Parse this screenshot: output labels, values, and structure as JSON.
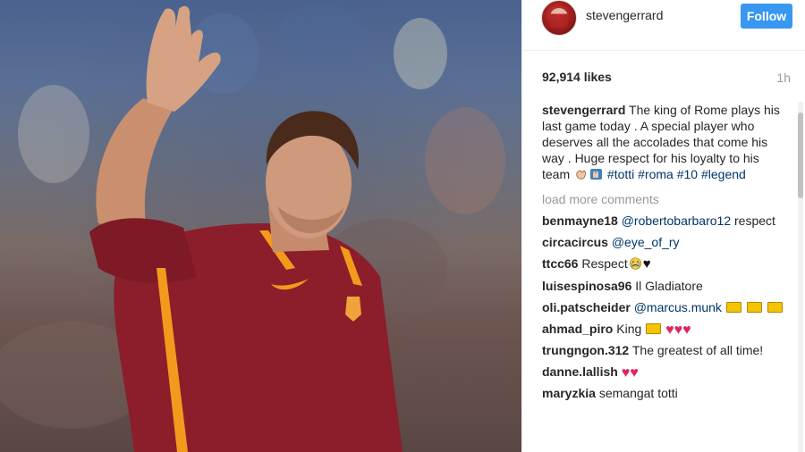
{
  "post": {
    "username": "stevengerrard",
    "follow_label": "Follow",
    "likes": "92,914 likes",
    "time": "1h"
  },
  "caption": {
    "user": "stevengerrard",
    "text": "The king of Rome plays his last game today . A special player who deserves all the accolades that come his way . Huge respect for his loyalty to his team",
    "tags": [
      "#totti",
      "#roma",
      "#10",
      "#legend"
    ]
  },
  "load_more": "load more comments",
  "comments": [
    {
      "user": "benmayne18",
      "mention": "@robertobarbaro12",
      "text": "respect"
    },
    {
      "user": "circacircus",
      "mention": "@eye_of_ry",
      "text": ""
    },
    {
      "user": "ttcc66",
      "text": "Respect"
    },
    {
      "user": "luisespinosa96",
      "text": "Il Gladiatore"
    },
    {
      "user": "oli.patscheider",
      "mention": "@marcus.munk",
      "text": ""
    },
    {
      "user": "ahmad_piro",
      "text": "King"
    },
    {
      "user": "trungngon.312",
      "text": "The greatest of all time!"
    },
    {
      "user": "danne.lallish",
      "text": ""
    },
    {
      "user": "maryzkia",
      "text": "semangat totti"
    }
  ],
  "icons": {
    "heart": "♥",
    "black_heart": "♥"
  },
  "colors": {
    "follow": "#3897f0",
    "link": "#003569",
    "muted": "#999999",
    "heart": "#e0245e",
    "jersey": "#8b1e2a",
    "jersey_stripe": "#f39a1d"
  }
}
